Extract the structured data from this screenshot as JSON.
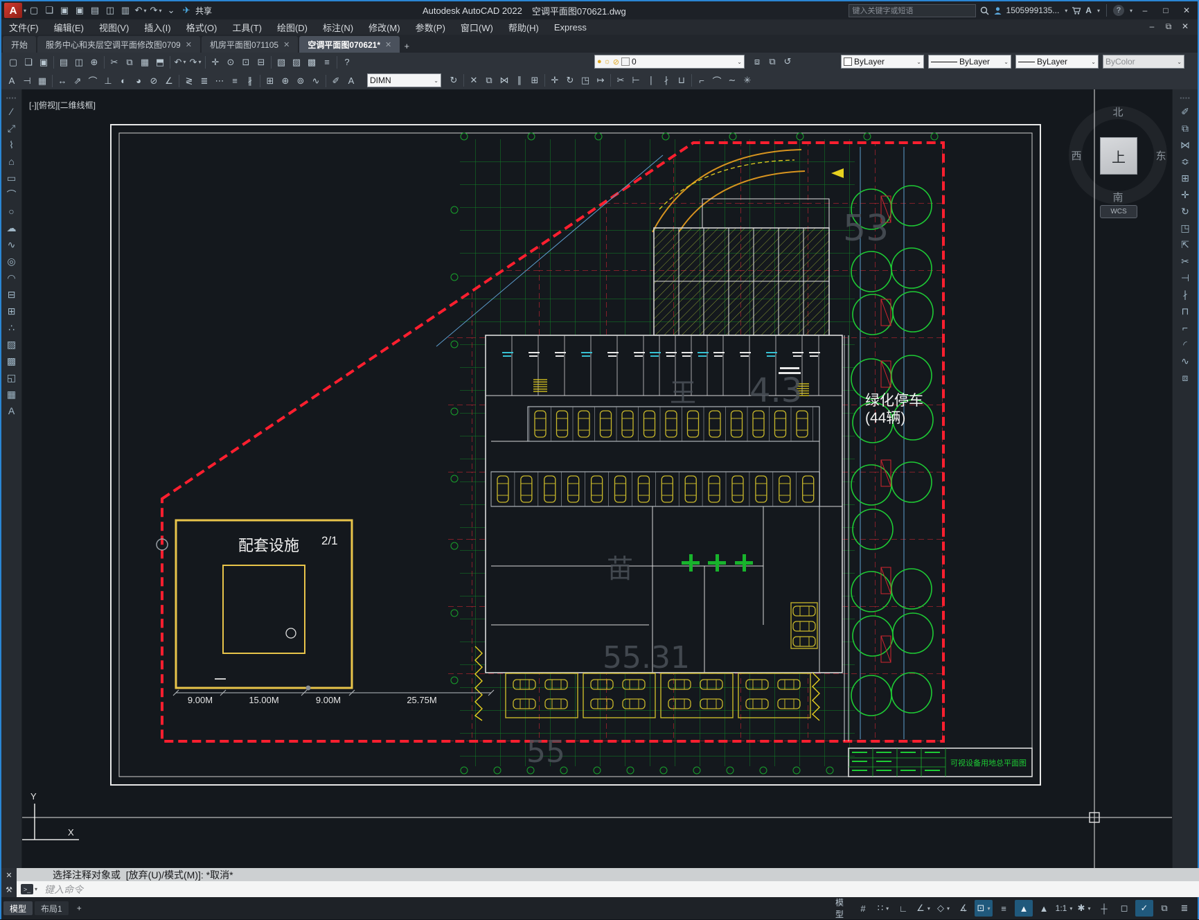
{
  "window": {
    "app_title": "Autodesk AutoCAD 2022",
    "doc_title": "空调平面图070621.dwg",
    "share_label": "共享",
    "search_placeholder": "键入关键字或短语",
    "account_id": "1505999135...",
    "min": "–",
    "max": "□",
    "close": "✕",
    "restore": "⧉"
  },
  "menu": {
    "items": [
      "文件(F)",
      "编辑(E)",
      "视图(V)",
      "插入(I)",
      "格式(O)",
      "工具(T)",
      "绘图(D)",
      "标注(N)",
      "修改(M)",
      "参数(P)",
      "窗口(W)",
      "帮助(H)",
      "Express"
    ]
  },
  "file_tabs": {
    "tabs": [
      {
        "label": "开始",
        "closable": false,
        "active": false
      },
      {
        "label": "服务中心和夹层空调平面修改图0709",
        "closable": true,
        "active": false
      },
      {
        "label": "机房平面图071105",
        "closable": true,
        "active": false
      },
      {
        "label": "空调平面图070621*",
        "closable": true,
        "active": true
      }
    ],
    "add": "+"
  },
  "toolbars": {
    "layer_value": "0",
    "color_value": "ByLayer",
    "linetype_value": "ByLayer",
    "lineweight_value": "ByLayer",
    "plotstyle_value": "ByColor",
    "dimstyle_value": "DIMN"
  },
  "icons": {
    "qat": [
      {
        "n": "new-file",
        "g": "▢"
      },
      {
        "n": "open-file",
        "g": "❏"
      },
      {
        "n": "save",
        "g": "▣"
      },
      {
        "n": "save-as",
        "g": "▣"
      },
      {
        "n": "plot",
        "g": "▤"
      },
      {
        "n": "batch-plot",
        "g": "◫"
      },
      {
        "n": "print",
        "g": "▥"
      },
      {
        "n": "undo",
        "g": "↶",
        "c": true
      },
      {
        "n": "redo",
        "g": "↷",
        "c": true
      },
      {
        "n": "qat-customize",
        "g": "⌄"
      },
      {
        "n": "share",
        "g": "✈",
        "colored": true
      }
    ],
    "std": [
      {
        "n": "new-file",
        "g": "▢"
      },
      {
        "n": "open-file",
        "g": "❏"
      },
      {
        "n": "save",
        "g": "▣"
      },
      {
        "sep": true
      },
      {
        "n": "plot",
        "g": "▤"
      },
      {
        "n": "plot-preview",
        "g": "◫"
      },
      {
        "n": "publish",
        "g": "⊕"
      },
      {
        "sep": true
      },
      {
        "n": "cut-clip",
        "g": "✂"
      },
      {
        "n": "copy-clip",
        "g": "⧉"
      },
      {
        "n": "paste-clip",
        "g": "▦"
      },
      {
        "n": "match-properties",
        "g": "⬒"
      },
      {
        "sep": true
      },
      {
        "n": "undo",
        "g": "↶",
        "c": true
      },
      {
        "n": "redo",
        "g": "↷",
        "c": true
      },
      {
        "sep": true
      },
      {
        "n": "pan",
        "g": "✛"
      },
      {
        "n": "zoom-realtime",
        "g": "⊙"
      },
      {
        "n": "zoom-window",
        "g": "⊡"
      },
      {
        "n": "zoom-previous",
        "g": "⊟"
      },
      {
        "sep": true
      },
      {
        "n": "layer-properties",
        "g": "▧"
      },
      {
        "n": "layer-states",
        "g": "▨"
      },
      {
        "n": "layer-off",
        "g": "▩"
      },
      {
        "n": "properties-palette",
        "g": "≡"
      },
      {
        "sep": true
      },
      {
        "n": "help",
        "g": "?"
      }
    ],
    "layer_tools": [
      {
        "n": "make-object-layer-current",
        "g": "⧈"
      },
      {
        "n": "layer-match",
        "g": "⧉"
      },
      {
        "n": "layer-previous",
        "g": "↺"
      }
    ],
    "dims": [
      {
        "n": "text-style",
        "g": "A"
      },
      {
        "n": "dimension-style",
        "g": "⊣"
      },
      {
        "n": "table-style",
        "g": "▦"
      },
      {
        "sep": true
      },
      {
        "n": "linear-dimension",
        "g": "↔"
      },
      {
        "n": "aligned-dimension",
        "g": "⇗"
      },
      {
        "n": "arc-length-dimension",
        "g": "⌒"
      },
      {
        "n": "ordinate-dimension",
        "g": "⊥"
      },
      {
        "n": "radius-dimension",
        "g": "◐"
      },
      {
        "n": "jogged-dimension",
        "g": "◕"
      },
      {
        "n": "diameter-dimension",
        "g": "⊘"
      },
      {
        "n": "angular-dimension",
        "g": "∠"
      },
      {
        "sep": true
      },
      {
        "n": "quick-dimension",
        "g": "≷"
      },
      {
        "n": "baseline-dimension",
        "g": "≣"
      },
      {
        "n": "continue-dimension",
        "g": "⋯"
      },
      {
        "n": "dimension-spacing",
        "g": "≡"
      },
      {
        "n": "dimension-break",
        "g": "∦"
      },
      {
        "sep": true
      },
      {
        "n": "tolerance",
        "g": "⊞"
      },
      {
        "n": "center-mark",
        "g": "⊕"
      },
      {
        "n": "inspection",
        "g": "⊚"
      },
      {
        "n": "jogged-linear",
        "g": "∿"
      },
      {
        "sep": true
      },
      {
        "n": "dimension-edit",
        "g": "✐"
      },
      {
        "n": "dimension-text-edit",
        "g": "A"
      }
    ],
    "mods": [
      {
        "n": "dimension-update",
        "g": "↻"
      },
      {
        "sep": true
      },
      {
        "n": "erase",
        "g": "✕"
      },
      {
        "n": "copy",
        "g": "⧉"
      },
      {
        "n": "mirror",
        "g": "⋈"
      },
      {
        "n": "offset",
        "g": "∥"
      },
      {
        "n": "array",
        "g": "⊞"
      },
      {
        "sep": true
      },
      {
        "n": "move",
        "g": "✛"
      },
      {
        "n": "rotate",
        "g": "↻"
      },
      {
        "n": "scale",
        "g": "◳"
      },
      {
        "n": "stretch",
        "g": "↦"
      },
      {
        "sep": true
      },
      {
        "n": "trim",
        "g": "✂"
      },
      {
        "n": "extend",
        "g": "⊢"
      },
      {
        "n": "break-at-point",
        "g": "∣"
      },
      {
        "n": "break",
        "g": "∤"
      },
      {
        "n": "join",
        "g": "⊔"
      },
      {
        "sep": true
      },
      {
        "n": "chamfer",
        "g": "⌐"
      },
      {
        "n": "fillet",
        "g": "⌒"
      },
      {
        "n": "blend-curves",
        "g": "∼"
      },
      {
        "n": "explode",
        "g": "✳"
      }
    ],
    "draw": [
      {
        "n": "line",
        "g": "∕"
      },
      {
        "n": "construction-line",
        "g": "⤢"
      },
      {
        "n": "polyline",
        "g": "⌇"
      },
      {
        "n": "polygon",
        "g": "⌂"
      },
      {
        "n": "rectangle",
        "g": "▭"
      },
      {
        "n": "arc",
        "g": "⌒"
      },
      {
        "n": "circle",
        "g": "○"
      },
      {
        "n": "revision-cloud",
        "g": "☁"
      },
      {
        "n": "spline",
        "g": "∿"
      },
      {
        "n": "ellipse",
        "g": "◎"
      },
      {
        "n": "ellipse-arc",
        "g": "◠"
      },
      {
        "n": "insert-block",
        "g": "⊟"
      },
      {
        "n": "create-block",
        "g": "⊞"
      },
      {
        "n": "point",
        "g": "∴"
      },
      {
        "n": "hatch",
        "g": "▨"
      },
      {
        "n": "gradient",
        "g": "▩"
      },
      {
        "n": "region",
        "g": "◱"
      },
      {
        "n": "table",
        "g": "▦"
      },
      {
        "n": "multiline-text",
        "g": "A"
      }
    ],
    "modify": [
      {
        "n": "erase",
        "g": "✐"
      },
      {
        "n": "copy",
        "g": "⧉"
      },
      {
        "n": "mirror",
        "g": "⋈"
      },
      {
        "n": "offset",
        "g": "≎"
      },
      {
        "n": "array",
        "g": "⊞"
      },
      {
        "n": "move",
        "g": "✛"
      },
      {
        "n": "rotate",
        "g": "↻"
      },
      {
        "n": "scale",
        "g": "◳"
      },
      {
        "n": "stretch",
        "g": "⇱"
      },
      {
        "n": "trim",
        "g": "✂"
      },
      {
        "n": "extend",
        "g": "⊣"
      },
      {
        "n": "break",
        "g": "∤"
      },
      {
        "n": "join",
        "g": "⊓"
      },
      {
        "n": "chamfer",
        "g": "⌐"
      },
      {
        "n": "fillet",
        "g": "◜"
      },
      {
        "n": "spline-edit",
        "g": "∿"
      },
      {
        "n": "explode",
        "g": "⧈"
      }
    ],
    "status": [
      {
        "n": "model-paper-toggle",
        "g": "模型",
        "wide": true
      },
      {
        "n": "grid-display",
        "g": "#"
      },
      {
        "n": "snap-mode",
        "g": "∷",
        "c": true
      },
      {
        "n": "ortho-mode",
        "g": "∟"
      },
      {
        "n": "polar-tracking",
        "g": "∠",
        "c": true
      },
      {
        "n": "isodraft",
        "g": "◇",
        "c": true
      },
      {
        "n": "object-snap-tracking",
        "g": "∡"
      },
      {
        "n": "object-snap",
        "g": "⊡",
        "a": true,
        "c": true
      },
      {
        "n": "lineweight-display",
        "g": "≡"
      },
      {
        "n": "annotation-visibility",
        "g": "▲",
        "a": true
      },
      {
        "n": "auto-annotation-scale",
        "g": "▲"
      },
      {
        "n": "annotation-scale",
        "g": "1:1",
        "wide": true,
        "c": true
      },
      {
        "n": "workspace-switching",
        "g": "✱",
        "c": true
      },
      {
        "n": "crosshair-settings",
        "g": "┼"
      },
      {
        "n": "object-isolate",
        "g": "◻"
      },
      {
        "n": "hardware-acceleration",
        "g": "✓",
        "a": true
      },
      {
        "n": "clean-screen",
        "g": "⧉"
      },
      {
        "n": "status-customize",
        "g": "≣"
      }
    ]
  },
  "canvas": {
    "viewport_label": "[-][俯视][二维线框]",
    "green_parking": [
      "绿化停车",
      "(44辆)"
    ],
    "facility_label": "配套设施",
    "facility_code": "2/1",
    "dims": [
      "9.00M",
      "15.00M",
      "9.00M",
      "25.75M"
    ],
    "watermarks": [
      "53",
      "4.3",
      "王",
      "苗",
      "55.31",
      "55"
    ],
    "titleblock_title": "可视设备用地总平面图",
    "compass": {
      "n": "北",
      "s": "南",
      "w": "西",
      "e": "东",
      "center": "上",
      "wcs": "WCS"
    },
    "ucs": {
      "x": "X",
      "y": "Y"
    }
  },
  "command": {
    "history": "选择注释对象或  [放弃(U)/模式(M)]: *取消*",
    "placeholder": "键入命令",
    "close": "✕",
    "tools": "⚒"
  },
  "layout_tabs": {
    "model": "模型",
    "layout": "布局1",
    "add": "+"
  }
}
